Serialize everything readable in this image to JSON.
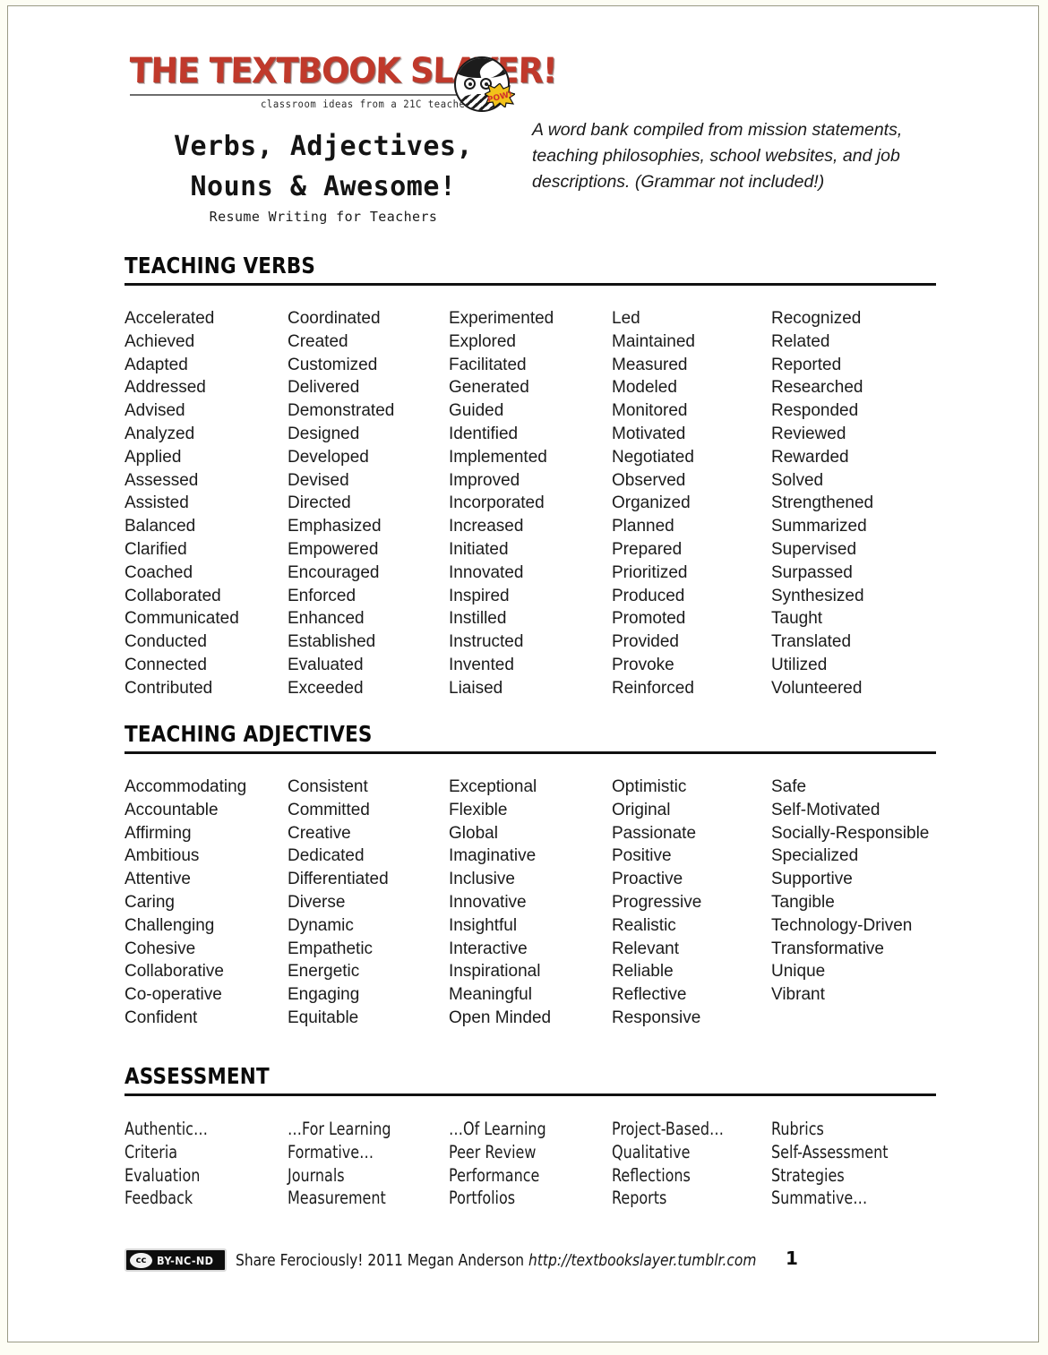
{
  "brand": {
    "wordmark": "THE TEXTBOOK SLAYER!",
    "tagline": "classroom  ideas from a 21C teacher",
    "mascot_pow": "POW!",
    "accent_red": "#c0392b",
    "pow_yellow": "#f2c21a",
    "pow_red": "#d2302a"
  },
  "header": {
    "title_line1": "Verbs, Adjectives,",
    "title_line2": "Nouns & Awesome!",
    "subtitle": "Resume Writing for Teachers",
    "description": "A word bank compiled from mission statements, teaching philosophies, school websites, and job descriptions. (Grammar not included!)"
  },
  "sections": [
    {
      "id": "verbs",
      "heading": "TEACHING VERBS",
      "columns": [
        [
          "Accelerated",
          "Achieved",
          "Adapted",
          "Addressed",
          "Advised",
          "Analyzed",
          "Applied",
          "Assessed",
          "Assisted",
          "Balanced",
          "Clarified",
          "Coached",
          "Collaborated",
          "Communicated",
          "Conducted",
          "Connected",
          "Contributed"
        ],
        [
          "Coordinated",
          "Created",
          "Customized",
          "Delivered",
          "Demonstrated",
          "Designed",
          "Developed",
          "Devised",
          "Directed",
          "Emphasized",
          "Empowered",
          "Encouraged",
          "Enforced",
          "Enhanced",
          "Established",
          "Evaluated",
          "Exceeded"
        ],
        [
          "Experimented",
          "Explored",
          "Facilitated",
          "Generated",
          "Guided",
          "Identified",
          "Implemented",
          "Improved",
          "Incorporated",
          "Increased",
          "Initiated",
          "Innovated",
          "Inspired",
          "Instilled",
          "Instructed",
          "Invented",
          "Liaised"
        ],
        [
          "Led",
          "Maintained",
          "Measured",
          "Modeled",
          "Monitored",
          "Motivated",
          "Negotiated",
          "Observed",
          "Organized",
          "Planned",
          "Prepared",
          "Prioritized",
          "Produced",
          "Promoted",
          "Provided",
          "Provoke",
          "Reinforced"
        ],
        [
          "Recognized",
          "Related",
          "Reported",
          "Researched",
          "Responded",
          "Reviewed",
          "Rewarded",
          "Solved",
          "Strengthened",
          "Summarized",
          "Supervised",
          "Surpassed",
          "Synthesized",
          "Taught",
          "Translated",
          "Utilized",
          "Volunteered"
        ]
      ]
    },
    {
      "id": "adjectives",
      "heading": "TEACHING ADJECTIVES",
      "columns": [
        [
          "Accommodating",
          "Accountable",
          "Affirming",
          "Ambitious",
          "Attentive",
          "Caring",
          "Challenging",
          "Cohesive",
          "Collaborative",
          "Co-operative",
          "Confident"
        ],
        [
          "Consistent",
          "Committed",
          "Creative",
          "Dedicated",
          "Differentiated",
          "Diverse",
          "Dynamic",
          "Empathetic",
          "Energetic",
          "Engaging",
          "Equitable"
        ],
        [
          "Exceptional",
          "Flexible",
          "Global",
          "Imaginative",
          "Inclusive",
          "Innovative",
          "Insightful",
          "Interactive",
          "Inspirational",
          "Meaningful",
          "Open Minded"
        ],
        [
          "Optimistic",
          "Original",
          "Passionate",
          "Positive",
          "Proactive",
          "Progressive",
          "Realistic",
          "Relevant",
          "Reliable",
          "Reflective",
          "Responsive"
        ],
        [
          "Safe",
          "Self-Motivated",
          "Socially-Responsible",
          "Specialized",
          "Supportive",
          "Tangible",
          "Technology-Driven",
          "Transformative",
          "Unique",
          "Vibrant"
        ]
      ]
    },
    {
      "id": "assessment",
      "heading": "ASSESSMENT",
      "columns": [
        [
          "Authentic…",
          "Criteria",
          "Evaluation",
          "Feedback"
        ],
        [
          "…For Learning",
          "Formative…",
          "Journals",
          "Measurement"
        ],
        [
          "…Of Learning",
          "Peer Review",
          "Performance",
          "Portfolios"
        ],
        [
          "Project-Based…",
          "Qualitative",
          "Reflections",
          "Reports"
        ],
        [
          "Rubrics",
          "Self-Assessment",
          "Strategies",
          "Summative…"
        ]
      ]
    }
  ],
  "footer": {
    "cc_mark": "cc",
    "cc_terms": "BY-NC-ND",
    "credit": "Share Ferociously! 2011 Megan Anderson ",
    "url": "http://textbookslayer.tumblr.com",
    "page_number": "1"
  }
}
